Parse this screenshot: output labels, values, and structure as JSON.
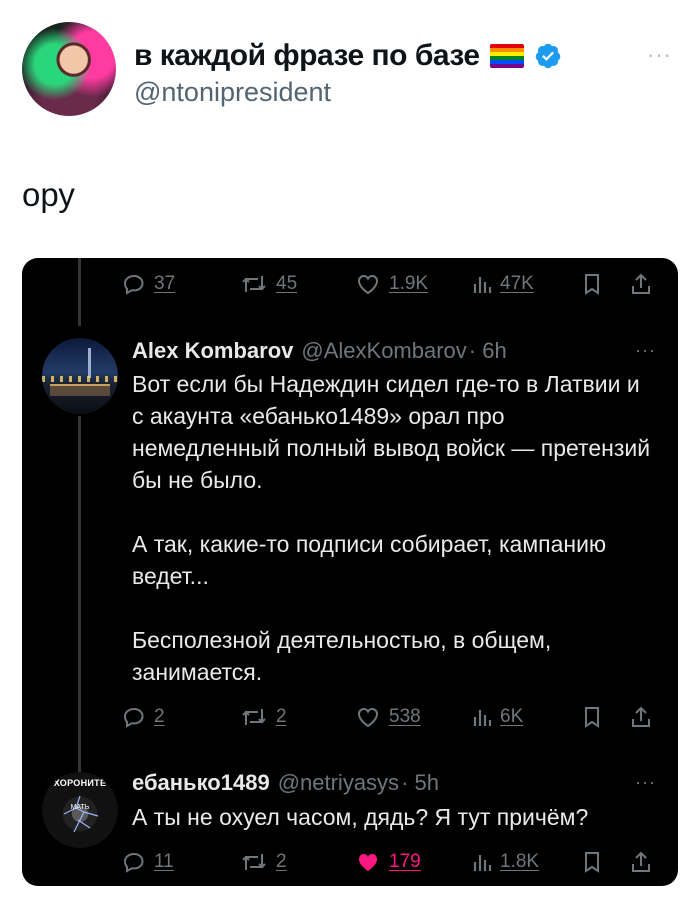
{
  "outer": {
    "display_name": "в каждой фразе по базе",
    "handle": "@ntonipresident",
    "text": "ору",
    "more_label": "···",
    "flag_colors": [
      "#e40303",
      "#ff8c00",
      "#ffed00",
      "#008026",
      "#004dff",
      "#750787"
    ],
    "verified_color": "#1d9bf0"
  },
  "card": {
    "top_actions": {
      "replies": "37",
      "reposts": "45",
      "likes": "1.9K",
      "views": "47K"
    },
    "tweets": [
      {
        "name": "Alex Kombarov",
        "handle": "@AlexKombarov",
        "time": "· 6h",
        "more_label": "···",
        "paragraphs": [
          "Вот если бы Надеждин сидел где-то в Латвии и с акаунта «ебанько1489» орал про немедленный полный вывод войск — претензий бы не было.",
          "А так, какие-то подписи собирает, кампанию ведет...",
          "Бесполезной деятельностью, в общем, занимается."
        ],
        "actions": {
          "replies": "2",
          "reposts": "2",
          "likes": "538",
          "views": "6K",
          "liked": false
        }
      },
      {
        "name": "ебанько1489",
        "handle": "@netriyasys",
        "time": "· 5h",
        "more_label": "···",
        "avatar_caption_top": "ХОРОНИТЕ",
        "avatar_caption_mid": "МАТЬ",
        "paragraphs": [
          "А ты не охуел часом, дядь? Я тут причём?"
        ],
        "actions": {
          "replies": "11",
          "reposts": "2",
          "likes": "179",
          "views": "1.8K",
          "liked": true
        }
      }
    ]
  },
  "colors": {
    "like_active": "#f91880",
    "muted": "#71767b"
  }
}
